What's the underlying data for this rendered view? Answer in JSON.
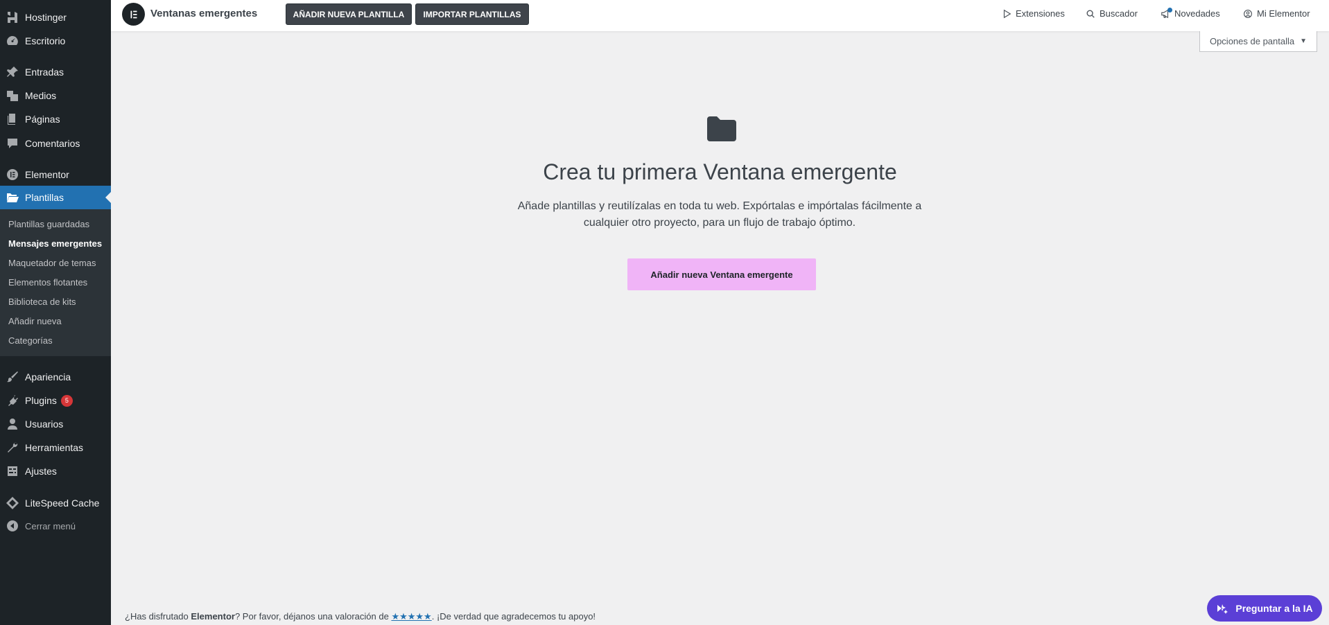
{
  "sidebar": {
    "items": [
      {
        "label": "Hostinger",
        "icon": "hostinger-icon"
      },
      {
        "label": "Escritorio",
        "icon": "dashboard-icon"
      },
      {
        "label": "Entradas",
        "icon": "pin-icon"
      },
      {
        "label": "Medios",
        "icon": "media-icon"
      },
      {
        "label": "Páginas",
        "icon": "pages-icon"
      },
      {
        "label": "Comentarios",
        "icon": "comments-icon"
      },
      {
        "label": "Elementor",
        "icon": "elementor-icon"
      },
      {
        "label": "Plantillas",
        "icon": "folder-open-icon"
      },
      {
        "label": "Apariencia",
        "icon": "brush-icon"
      },
      {
        "label": "Plugins",
        "icon": "plugin-icon",
        "badge": "5"
      },
      {
        "label": "Usuarios",
        "icon": "user-icon"
      },
      {
        "label": "Herramientas",
        "icon": "wrench-icon"
      },
      {
        "label": "Ajustes",
        "icon": "settings-icon"
      },
      {
        "label": "LiteSpeed Cache",
        "icon": "diamond-icon"
      }
    ],
    "collapse_label": "Cerrar menú",
    "submenu": [
      "Plantillas guardadas",
      "Mensajes emergentes",
      "Maquetador de temas",
      "Elementos flotantes",
      "Biblioteca de kits",
      "Añadir nueva",
      "Categorías"
    ]
  },
  "topbar": {
    "title": "Ventanas emergentes",
    "add_template_label": "AÑADIR NUEVA PLANTILLA",
    "import_templates_label": "IMPORTAR PLANTILLAS",
    "links": {
      "extensions": "Extensiones",
      "search": "Buscador",
      "news": "Novedades",
      "my_elementor": "Mi Elementor"
    }
  },
  "screen_options_label": "Opciones de pantalla",
  "empty_state": {
    "title": "Crea tu primera Ventana emergente",
    "description": "Añade plantillas y reutilízalas en toda tu web. Expórtalas e impórtalas fácilmente a cualquier otro proyecto, para un flujo de trabajo óptimo.",
    "button_label": "Añadir nueva Ventana emergente"
  },
  "footer": {
    "prefix": "¿Has disfrutado ",
    "brand": "Elementor",
    "middle": "? Por favor, déjanos una valoración de ",
    "stars": "★★★★★",
    "suffix": ". ¡De verdad que agradecemos tu apoyo!"
  },
  "ai_button_label": "Preguntar a la IA",
  "colors": {
    "sidebar_bg": "#1d2327",
    "active_blue": "#2271b1",
    "accent_pink": "#f0b4f7",
    "ai_purple": "#5b3fd6",
    "badge_red": "#d63638"
  }
}
